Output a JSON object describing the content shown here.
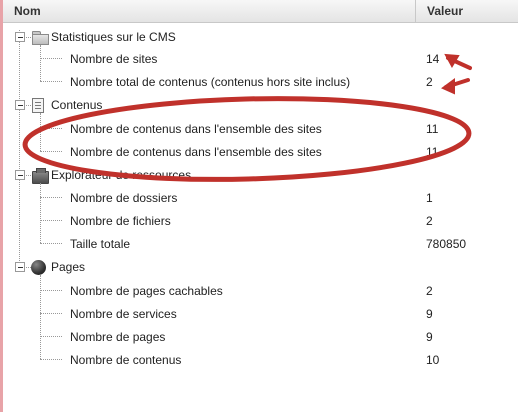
{
  "header": {
    "col_name": "Nom",
    "col_value": "Valeur"
  },
  "groups": [
    {
      "label": "Statistiques sur le CMS",
      "icon": "folder-icon",
      "rows": [
        {
          "label": "Nombre de sites",
          "value": "14"
        },
        {
          "label": "Nombre total de contenus (contenus hors site inclus)",
          "value": "2"
        }
      ]
    },
    {
      "label": "Contenus",
      "icon": "document-icon",
      "rows": [
        {
          "label": "Nombre de contenus dans l'ensemble des sites",
          "value": "11"
        },
        {
          "label": "Nombre de contenus dans l'ensemble des sites",
          "value": "11"
        }
      ]
    },
    {
      "label": "Explorateur de ressources",
      "icon": "resource-box-icon",
      "rows": [
        {
          "label": "Nombre de dossiers",
          "value": "1"
        },
        {
          "label": "Nombre de fichiers",
          "value": "2"
        },
        {
          "label": "Taille totale",
          "value": "780850"
        }
      ]
    },
    {
      "label": "Pages",
      "icon": "page-ball-icon",
      "rows": [
        {
          "label": "Nombre de pages cachables",
          "value": "2"
        },
        {
          "label": "Nombre de services",
          "value": "9"
        },
        {
          "label": "Nombre de pages",
          "value": "9"
        },
        {
          "label": "Nombre de contenus",
          "value": "10"
        }
      ]
    }
  ],
  "annotation_color": "#c0312b"
}
